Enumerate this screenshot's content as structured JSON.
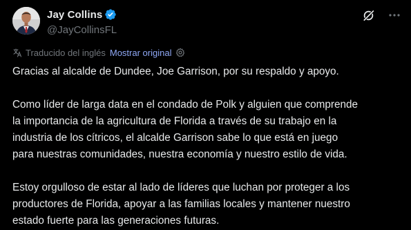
{
  "author": {
    "display_name": "Jay Collins",
    "handle": "@JayCollinsFL",
    "verified_icon": "verified-badge-icon"
  },
  "translation": {
    "translated_label": "Traducido del inglés",
    "show_original_label": "Mostrar original"
  },
  "tweet": {
    "paragraphs": [
      "Gracias al alcalde de Dundee, Joe Garrison, por su respaldo y apoyo.",
      "Como líder de larga data en el condado de Polk y alguien que comprende\nla importancia de la agricultura de Florida a través de su trabajo en la\nindustria de los cítricos, el alcalde Garrison sabe lo que está en juego\npara nuestras comunidades, nuestra economía y nuestro estilo de vida.",
      "Estoy orgulloso de estar al lado de líderes que luchan por proteger a los\nproductores de Florida, apoyar a las familias locales y mantener nuestro\nestado fuerte para las generaciones futuras."
    ]
  },
  "colors": {
    "background": "#000000",
    "text_primary": "#e7e9ea",
    "text_secondary": "#71767b",
    "link": "#8fa8f5",
    "verified_blue": "#1d9bf0"
  },
  "icons": {
    "grok": "grok-icon",
    "more": "more-options-icon",
    "translate": "translate-icon",
    "settings": "translation-settings-icon"
  }
}
